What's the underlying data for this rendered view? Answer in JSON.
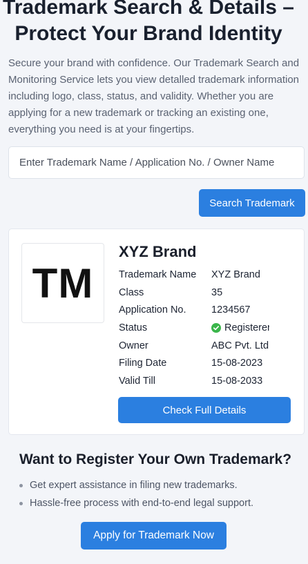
{
  "hero": {
    "title": "Trademark Search & Details – Protect Your Brand Identity",
    "intro": "Secure your brand with confidence. Our Trademark Search and Monitoring Service lets you view detalled trademark information including logo, class, status, and validity. Whether you are applying for a new trademark or tracking an existing one, everything you need is at your fingertips."
  },
  "search": {
    "placeholder": "Enter Trademark Name / Application No. / Owner Name",
    "button_label": "Search Trademark"
  },
  "result": {
    "logo_text": "TM",
    "brand_name": "XYZ Brand",
    "details": [
      {
        "label": "Trademark Name",
        "value": "XYZ Brand"
      },
      {
        "label": "Class",
        "value": "35"
      },
      {
        "label": "Application No.",
        "value": "1234567"
      },
      {
        "label": "Status",
        "value": "Registerer",
        "icon": "check-circle-icon",
        "icon_color": "#3ab54a"
      },
      {
        "label": "Owner",
        "value": "ABC Pvt. Ltd."
      },
      {
        "label": "Filing Date",
        "value": "15-08-2023"
      },
      {
        "label": "Valid Till",
        "value": "15-08-2033"
      }
    ],
    "details_button_label": "Check Full Details"
  },
  "register": {
    "title": "Want to Register Your Own Trademark?",
    "benefits": [
      "Get expert assistance in filing new trademarks.",
      "Hassle-free process with end-to-end legal support."
    ],
    "apply_button_label": "Apply for Trademark Now"
  },
  "colors": {
    "accent": "#2b7fe0",
    "background": "#f3f5f9",
    "status_ok": "#3ab54a"
  }
}
